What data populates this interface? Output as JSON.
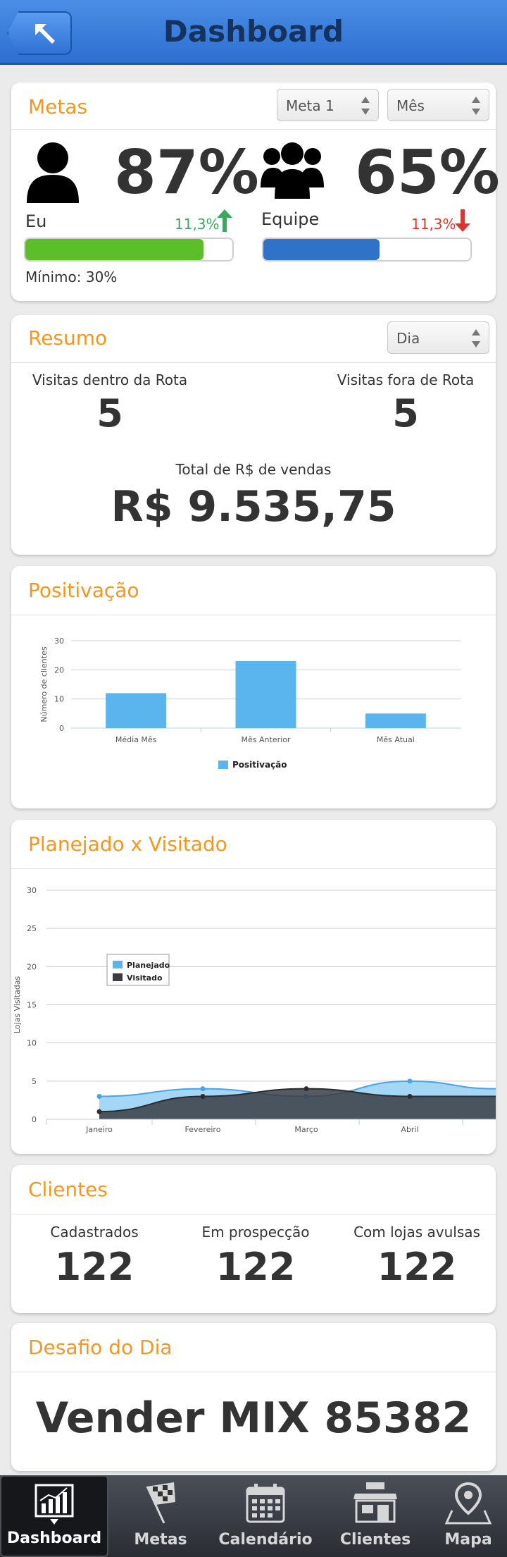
{
  "header": {
    "title": "Dashboard"
  },
  "metas": {
    "title": "Metas",
    "select_meta": "Meta 1",
    "select_period": "Mês",
    "eu": {
      "percent": "87%",
      "label": "Eu",
      "delta": "11,3%",
      "progress": 0.86,
      "bar_color": "#5cbf2a"
    },
    "equipe": {
      "percent": "65%",
      "label": "Equipe",
      "delta": "11,3%",
      "progress": 0.56,
      "bar_color": "#2f72c8"
    },
    "minimum": "Mínimo: 30%",
    "delta_up_color": "#3aa860",
    "delta_down_color": "#e0352b"
  },
  "resumo": {
    "title": "Resumo",
    "select_period": "Dia",
    "visitas_dentro_label": "Visitas dentro da Rota",
    "visitas_dentro_value": "5",
    "visitas_fora_label": "Visitas fora de Rota",
    "visitas_fora_value": "5",
    "total_label": "Total de R$ de vendas",
    "total_value": "R$ 9.535,75"
  },
  "positivacao": {
    "title": "Positivação",
    "chart_data": {
      "type": "bar",
      "categories": [
        "Média Mês",
        "Mês Anterior",
        "Mês Atual"
      ],
      "series": [
        {
          "name": "Positivação",
          "values": [
            12,
            23,
            5
          ]
        }
      ],
      "ylabel": "Número de clientes",
      "ylim": [
        0,
        30
      ],
      "yticks": [
        "0",
        "10",
        "20",
        "30"
      ],
      "grid": true,
      "legend": "bottom",
      "color": "#5ab4ee"
    }
  },
  "planejado": {
    "title": "Planejado x Visitado",
    "chart_data": {
      "type": "area",
      "categories": [
        "Janeiro",
        "Fevereiro",
        "Março",
        "Abril"
      ],
      "series": [
        {
          "name": "Planejado",
          "values": [
            3,
            4,
            3,
            5
          ],
          "color": "#5ab4ee"
        },
        {
          "name": "Visitado",
          "values": [
            1,
            3,
            4,
            3
          ],
          "color": "#3b3d44"
        }
      ],
      "ylabel": "Lojas Visitadas",
      "ylim": [
        0,
        30
      ],
      "yticks": [
        "0",
        "5",
        "10",
        "15",
        "20",
        "25",
        "30"
      ],
      "grid": true,
      "legend": "top-left"
    }
  },
  "clientes": {
    "title": "Clientes",
    "items": [
      {
        "label": "Cadastrados",
        "value": "122"
      },
      {
        "label": "Em prospecção",
        "value": "122"
      },
      {
        "label": "Com lojas avulsas",
        "value": "122"
      }
    ]
  },
  "desafio": {
    "title": "Desafio do Dia",
    "text": "Vender MIX 85382"
  },
  "tabs": [
    {
      "label": "Dashboard",
      "icon": "chart-icon"
    },
    {
      "label": "Metas",
      "icon": "checkered-flag-icon"
    },
    {
      "label": "Calendário",
      "icon": "calendar-icon"
    },
    {
      "label": "Clientes",
      "icon": "shop-icon"
    },
    {
      "label": "Mapa",
      "icon": "map-pin-icon"
    }
  ]
}
